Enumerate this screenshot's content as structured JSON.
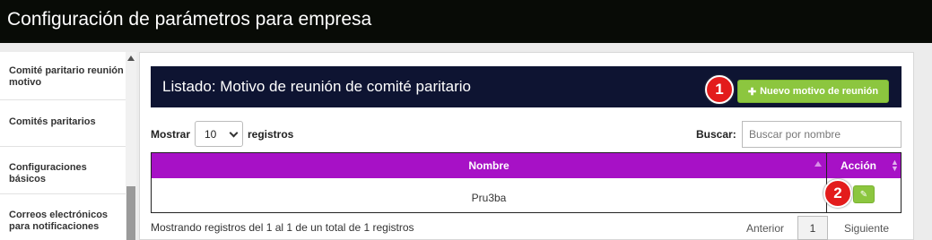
{
  "header": {
    "title": "Configuración de parámetros para empresa"
  },
  "sidebar": {
    "items": [
      {
        "label": "Comité paritario reunión motivo"
      },
      {
        "label": "Comités paritarios"
      },
      {
        "label": "Configuraciones básicos"
      },
      {
        "label": "Correos electrónicos para notificaciones"
      }
    ]
  },
  "panel": {
    "title": "Listado: Motivo de reunión de comité paritario",
    "new_button_label": "Nuevo motivo de reunión",
    "new_button_icon": "plus-icon"
  },
  "controls": {
    "show_label": "Mostrar",
    "page_size": "10",
    "records_label": "registros",
    "search_label": "Buscar:",
    "search_placeholder": "Buscar por nombre",
    "search_value": ""
  },
  "table": {
    "columns": [
      "Nombre",
      "Acción"
    ],
    "rows": [
      {
        "nombre": "Pru3ba",
        "action_icon": "pencil-icon"
      }
    ]
  },
  "footer": {
    "info": "Mostrando registros del 1 al 1 de un total de 1 registros",
    "prev": "Anterior",
    "current_page": "1",
    "next": "Siguiente"
  },
  "markers": [
    "1",
    "2"
  ],
  "colors": {
    "topbar": "#080b06",
    "panel_header": "#0e1432",
    "accent_green": "#8cc63f",
    "table_header": "#a711c6",
    "marker_red": "#e31c1c"
  }
}
